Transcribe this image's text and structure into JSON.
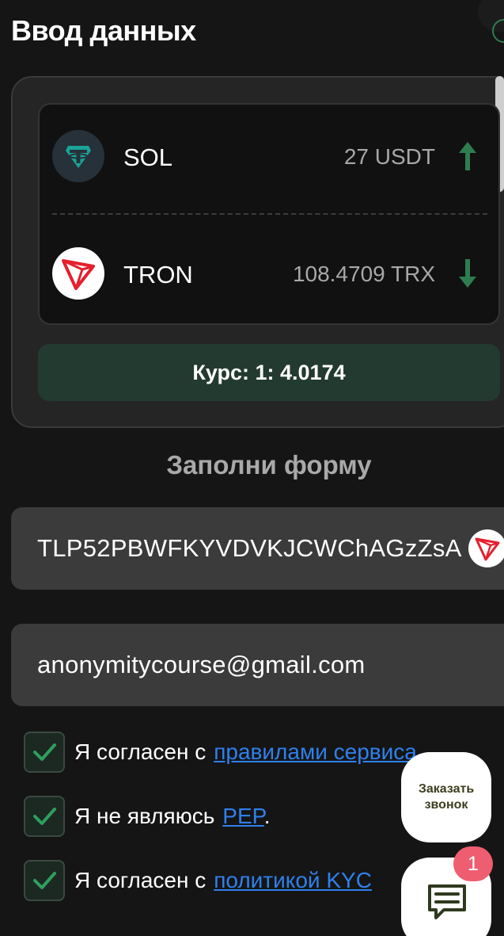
{
  "header": {
    "title": "Ввод данных"
  },
  "exchange": {
    "from": {
      "name": "SOL",
      "amount": "27 USDT",
      "direction": "up",
      "icon": "tether-icon"
    },
    "to": {
      "name": "TRON",
      "amount": "108.4709 TRX",
      "direction": "down",
      "icon": "tron-icon"
    },
    "rate": "Курс: 1: 4.0174"
  },
  "form": {
    "heading": "Заполни форму",
    "wallet_value": "TLP52PBWFKYVDVKJCWChAGzZsA",
    "wallet_icon": "tron-icon",
    "email_value": "anonymitycourse@gmail.com"
  },
  "agreements": [
    {
      "text": "Я согласен с",
      "link": "правилами сервиса",
      "suffix": "",
      "checked": true
    },
    {
      "text": "Я не являюсь",
      "link": "PEP",
      "suffix": ".",
      "checked": true
    },
    {
      "text": "Я согласен с",
      "link": "политикой KYC",
      "suffix": "",
      "checked": true
    }
  ],
  "widgets": {
    "callback_label": "Заказать звонок",
    "chat_badge": "1"
  },
  "colors": {
    "background": "#151515",
    "card": "#252525",
    "rate_bar": "#233a30",
    "accent_green": "#2e7d4f",
    "link": "#2f80ed",
    "badge": "#ef5d71"
  }
}
